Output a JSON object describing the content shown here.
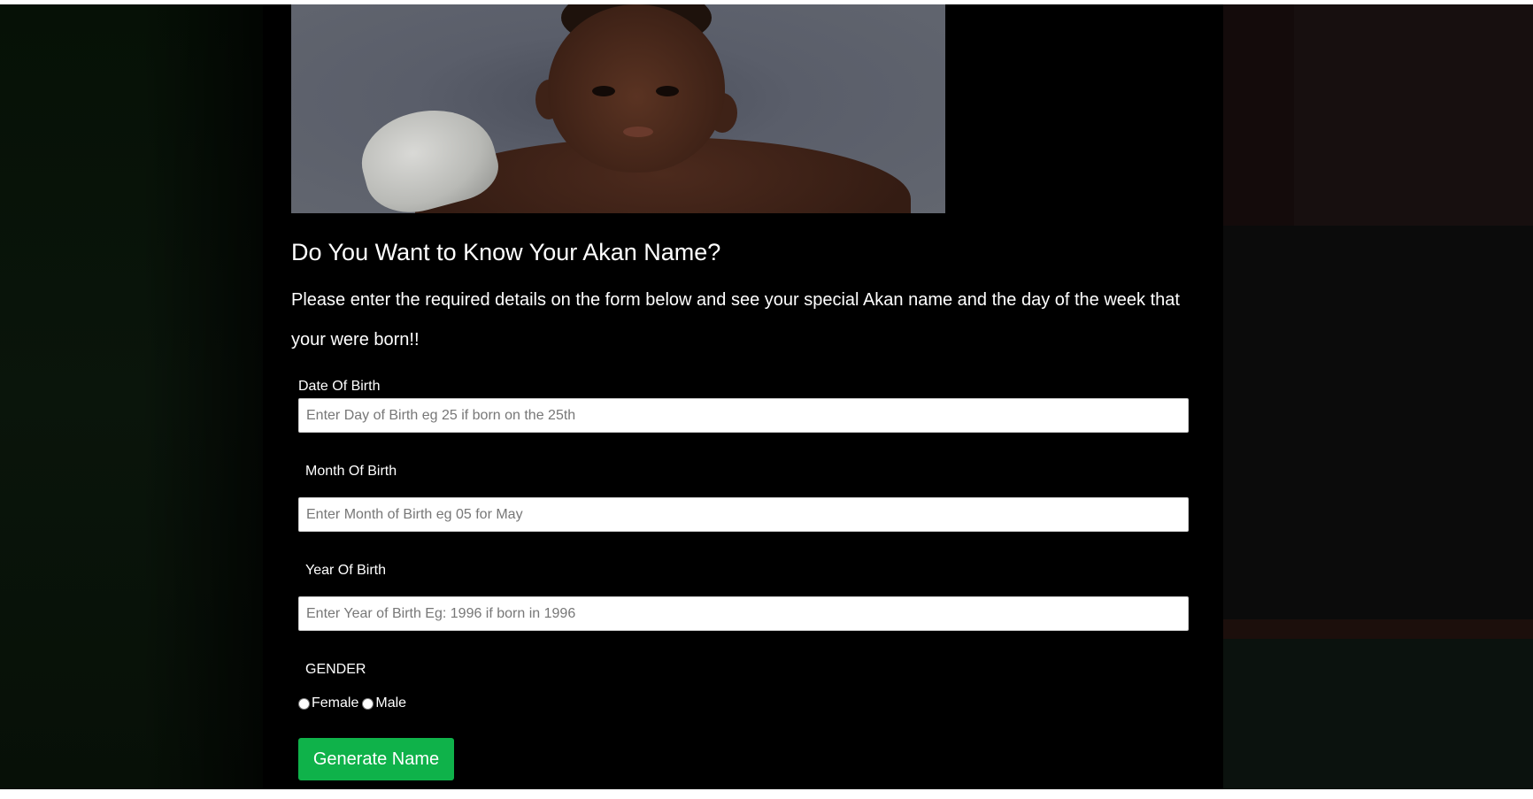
{
  "hero": {
    "image_icon": "baby-photo"
  },
  "heading": "Do You Want to Know Your Akan Name?",
  "intro": "Please enter the required details on the form below and see your special Akan name and the day of the week that your were born!!",
  "form": {
    "day": {
      "label": "Date Of Birth",
      "placeholder": "Enter Day of Birth eg 25 if born on the 25th"
    },
    "month": {
      "label": "Month Of Birth",
      "placeholder": "Enter Month of Birth eg 05 for May"
    },
    "year": {
      "label": "Year Of Birth",
      "placeholder": "Enter Year of Birth Eg: 1996 if born in 1996"
    },
    "gender": {
      "label": "GENDER",
      "options": [
        "Female",
        "Male"
      ]
    },
    "submit_label": "Generate Name"
  },
  "colors": {
    "button": "#0fb24a",
    "background": "#000000",
    "text": "#ffffff"
  }
}
